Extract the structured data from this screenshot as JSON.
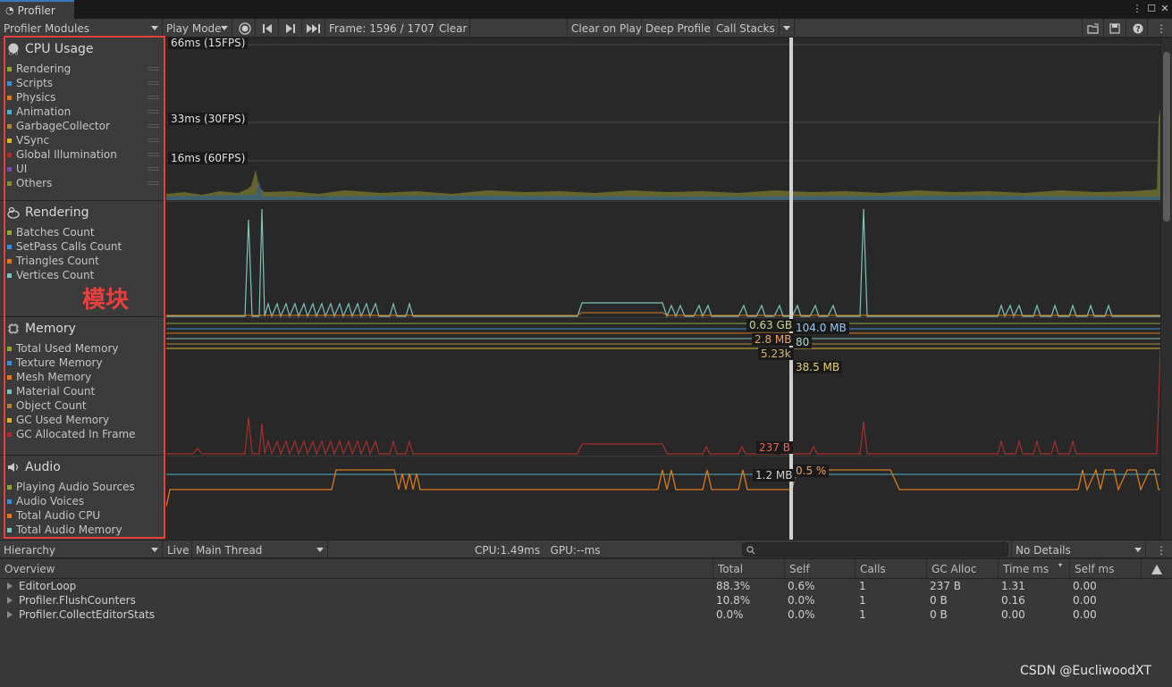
{
  "window": {
    "tab_title": "Profiler"
  },
  "toolbar": {
    "modules_dropdown": "Profiler Modules",
    "play_mode": "Play Mode",
    "frame": "Frame: 1596 / 1707",
    "clear": "Clear",
    "clear_on_play": "Clear on Play",
    "deep_profile": "Deep Profile",
    "call_stacks": "Call Stacks"
  },
  "modules": [
    {
      "title": "CPU Usage",
      "icon": "cpu-icon",
      "items": [
        {
          "label": "Rendering",
          "color": "#8fa83a"
        },
        {
          "label": "Scripts",
          "color": "#3a8fd0"
        },
        {
          "label": "Physics",
          "color": "#d97a1c"
        },
        {
          "label": "Animation",
          "color": "#4bb1c9"
        },
        {
          "label": "GarbageCollector",
          "color": "#b0843a"
        },
        {
          "label": "VSync",
          "color": "#d8b52b"
        },
        {
          "label": "Global Illumination",
          "color": "#a82d2d"
        },
        {
          "label": "UI",
          "color": "#7a4aa8"
        },
        {
          "label": "Others",
          "color": "#8a8a3a"
        }
      ]
    },
    {
      "title": "Rendering",
      "icon": "rendering-icon",
      "items": [
        {
          "label": "Batches Count",
          "color": "#8fa83a"
        },
        {
          "label": "SetPass Calls Count",
          "color": "#3a8fd0"
        },
        {
          "label": "Triangles Count",
          "color": "#d97a1c"
        },
        {
          "label": "Vertices Count",
          "color": "#7ec2b8"
        }
      ]
    },
    {
      "title": "Memory",
      "icon": "memory-icon",
      "items": [
        {
          "label": "Total Used Memory",
          "color": "#8fa83a"
        },
        {
          "label": "Texture Memory",
          "color": "#3a8fd0"
        },
        {
          "label": "Mesh Memory",
          "color": "#d97a1c"
        },
        {
          "label": "Material Count",
          "color": "#7ec2b8"
        },
        {
          "label": "Object Count",
          "color": "#b0843a"
        },
        {
          "label": "GC Used Memory",
          "color": "#d8b52b"
        },
        {
          "label": "GC Allocated In Frame",
          "color": "#a82d2d"
        }
      ]
    },
    {
      "title": "Audio",
      "icon": "audio-icon",
      "items": [
        {
          "label": "Playing Audio Sources",
          "color": "#8fa83a"
        },
        {
          "label": "Audio Voices",
          "color": "#3a8fd0"
        },
        {
          "label": "Total Audio CPU",
          "color": "#d97a1c"
        },
        {
          "label": "Total Audio Memory",
          "color": "#7ec2b8"
        }
      ]
    }
  ],
  "annotation": "模块",
  "graphs": {
    "cpu_fps_labels": [
      "66ms (15FPS)",
      "33ms (30FPS)",
      "16ms (60FPS)"
    ],
    "memory_values": [
      "0.63 GB",
      "104.0 MB",
      "2.8 MB",
      "80",
      "5.23k",
      "38.5 MB",
      "237 B"
    ],
    "audio_values": [
      "1.2 MB",
      "0.5 %"
    ]
  },
  "bottom_toolbar": {
    "view": "Hierarchy",
    "live": "Live",
    "thread": "Main Thread",
    "stats": "CPU:1.49ms   GPU:--ms",
    "search_placeholder": "",
    "details": "No Details"
  },
  "table": {
    "headers": [
      "Overview",
      "Total",
      "Self",
      "Calls",
      "GC Alloc",
      "Time ms",
      "Self ms"
    ],
    "rows": [
      [
        "EditorLoop",
        "88.3%",
        "0.6%",
        "1",
        "237 B",
        "1.31",
        "0.00"
      ],
      [
        "Profiler.FlushCounters",
        "10.8%",
        "0.0%",
        "1",
        "0 B",
        "0.16",
        "0.00"
      ],
      [
        "Profiler.CollectEditorStats",
        "0.0%",
        "0.0%",
        "1",
        "0 B",
        "0.00",
        "0.00"
      ]
    ]
  },
  "watermark": "CSDN @EucliwoodXT"
}
